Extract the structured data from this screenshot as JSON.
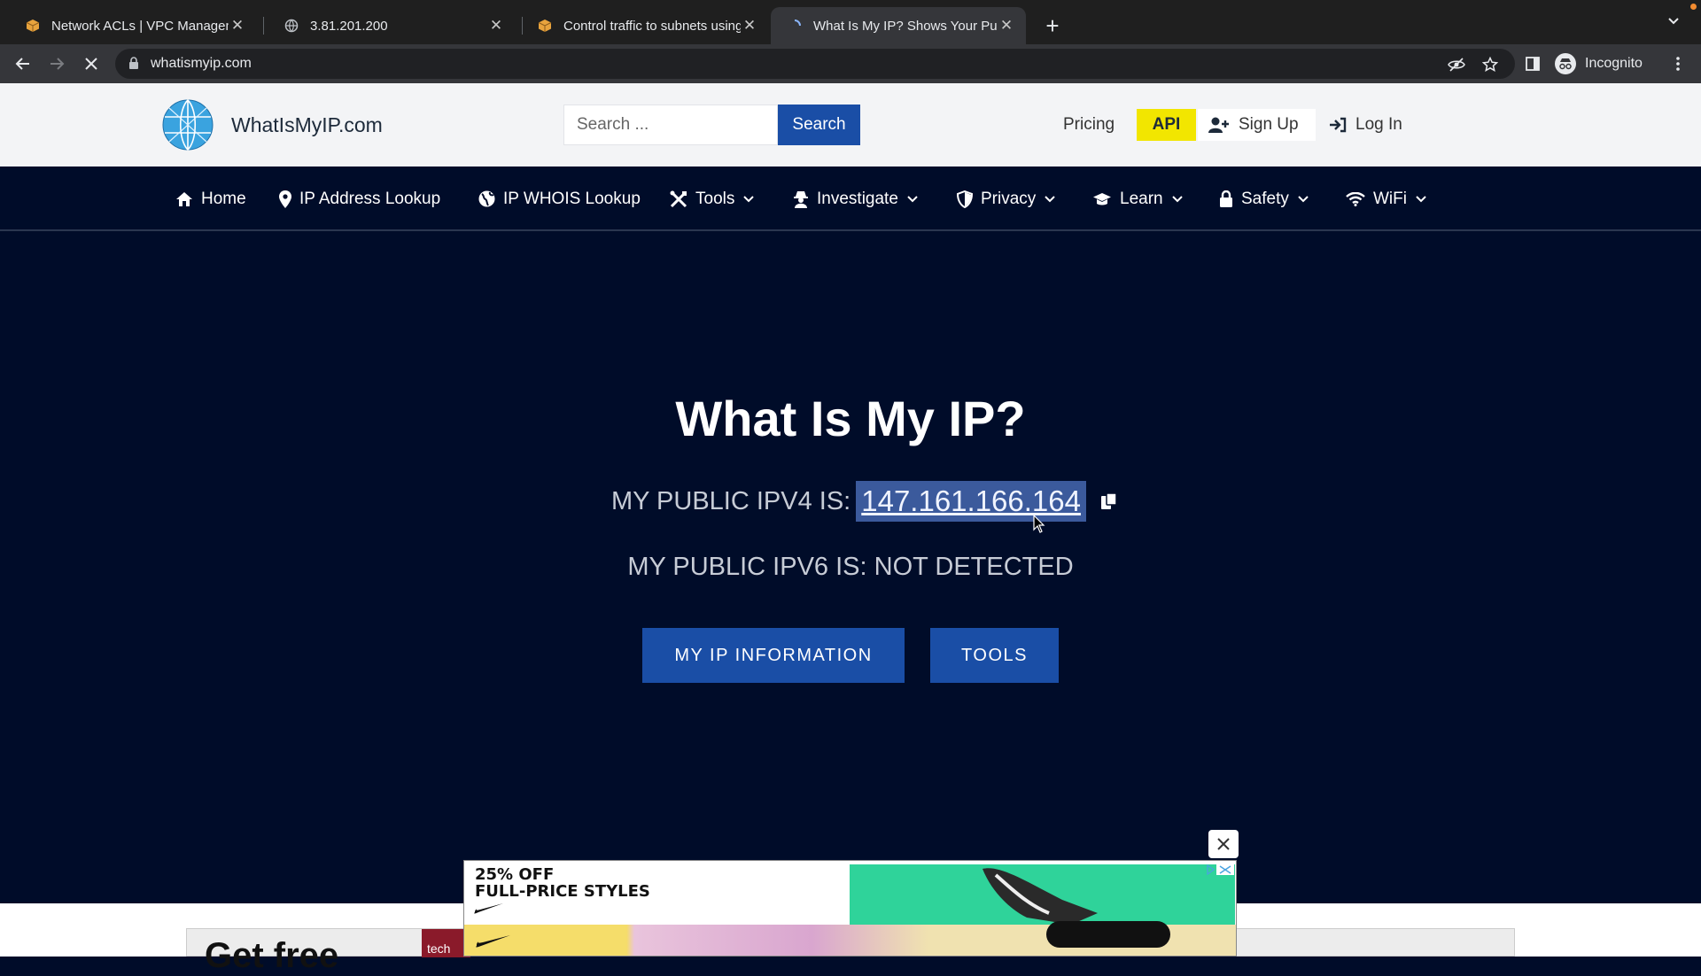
{
  "browser": {
    "tabs": [
      {
        "title": "Network ACLs | VPC Managem",
        "icon": "aws-box-icon"
      },
      {
        "title": "3.81.201.200",
        "icon": "globe-icon"
      },
      {
        "title": "Control traffic to subnets using",
        "icon": "aws-box-icon"
      },
      {
        "title": "What Is My IP? Shows Your Pu",
        "icon": "loading-spinner-icon",
        "active": true
      }
    ],
    "url": "whatismyip.com",
    "profile_label": "Incognito"
  },
  "header": {
    "brand": "WhatIsMyIP.com",
    "search_placeholder": "Search ...",
    "search_button": "Search",
    "pricing": "Pricing",
    "api": "API",
    "signup": "Sign Up",
    "login": "Log In",
    "accent_color": "#1a4ea6",
    "api_color": "#f2e600"
  },
  "nav": {
    "items": [
      {
        "label": "Home",
        "icon": "home-icon"
      },
      {
        "label": "IP Address Lookup",
        "icon": "map-pin-icon"
      },
      {
        "label": "IP WHOIS Lookup",
        "icon": "globe-icon"
      },
      {
        "label": "Tools",
        "icon": "tools-icon",
        "dropdown": true
      },
      {
        "label": "Investigate",
        "icon": "detective-icon",
        "dropdown": true
      },
      {
        "label": "Privacy",
        "icon": "shield-icon",
        "dropdown": true
      },
      {
        "label": "Learn",
        "icon": "graduation-cap-icon",
        "dropdown": true
      },
      {
        "label": "Safety",
        "icon": "lock-icon",
        "dropdown": true
      },
      {
        "label": "WiFi",
        "icon": "wifi-icon",
        "dropdown": true
      }
    ]
  },
  "hero": {
    "title": "What Is My IP?",
    "ipv4_label": "MY PUBLIC IPV4 IS:",
    "ipv4_value": "147.161.166.164",
    "ipv6_label": "MY PUBLIC IPV6 IS:",
    "ipv6_value": "NOT DETECTED",
    "btn_info": "MY IP INFORMATION",
    "btn_tools": "TOOLS"
  },
  "ad": {
    "headline_1": "25% OFF",
    "headline_2": "FULL-PRICE STYLES",
    "background_fragment": "Get free",
    "background_tag": "tech"
  }
}
